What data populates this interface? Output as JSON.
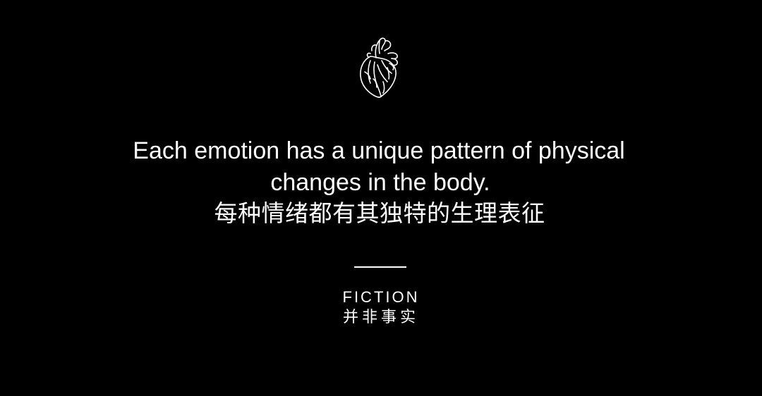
{
  "slide": {
    "icon": "anatomical-heart-icon",
    "background_color": "#000000",
    "text_color": "#ffffff",
    "quote": {
      "line1_en": "Each emotion has a unique pattern of physical",
      "line2_en": "changes in the body.",
      "line_zh": "每种情绪都有其独特的生理表征"
    },
    "tag": {
      "en": "FICTION",
      "zh": "并非事实"
    }
  }
}
